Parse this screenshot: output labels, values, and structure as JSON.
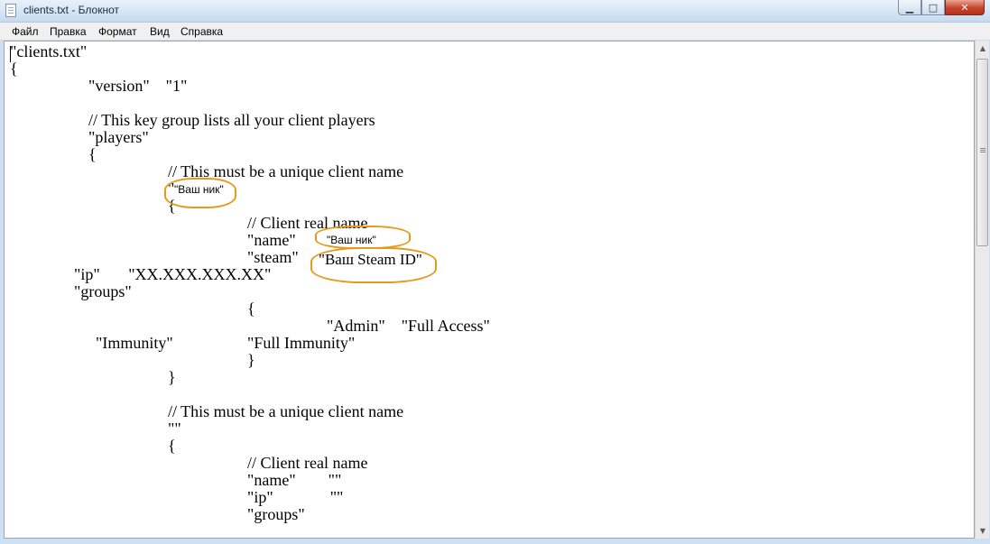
{
  "window": {
    "title": "clients.txt - Блокнот",
    "buttons": {
      "minimize": "▁",
      "maximize": "□",
      "close": "✕"
    }
  },
  "menu": [
    "Файл",
    "Правка",
    "Формат",
    "Вид",
    "Справка"
  ],
  "editor": {
    "lines": [
      "\"clients.txt\"",
      "{",
      "\"version\"    \"1\"",
      "// This key group lists all your client players",
      "\"players\"",
      "{",
      "// This must be a unique client name",
      "\"",
      "{",
      "// Client real name",
      "\"name\"",
      "\"steam\"",
      "\"ip\"       \"XX.XXX.XXX.XX\"",
      "\"groups\"",
      "{",
      "\"Admin\"    \"Full Access\"",
      "\"Immunity\"",
      "\"Full Immunity\"",
      "}",
      "}",
      "// This must be a unique client name",
      "\"\"",
      "{",
      "// Client real name",
      "\"name\"        \"\"",
      "\"ip\"              \"\"",
      "\"groups\""
    ],
    "highlights": [
      "\"Ваш ник\"",
      "\"Ваш ник\"",
      "\"Ваш Steam ID\""
    ]
  },
  "colors": {
    "highlight": "#e59a1b",
    "close_button": "#c7432a"
  }
}
